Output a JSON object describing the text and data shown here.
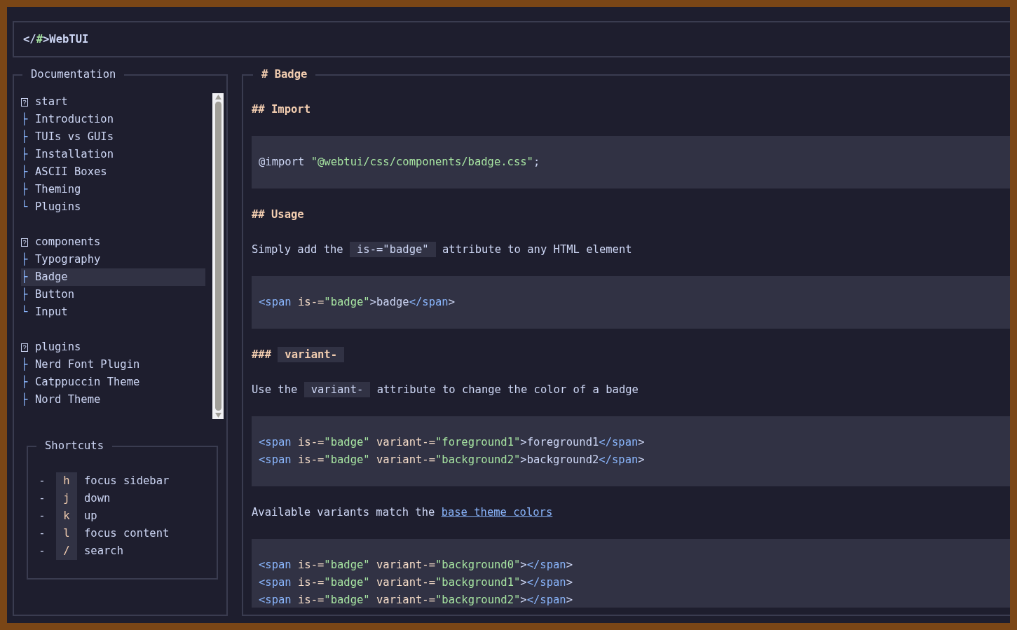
{
  "header": {
    "logo": [
      {
        "kind": "plain",
        "text": "</"
      },
      {
        "kind": "accent",
        "text": "#"
      },
      {
        "kind": "plain",
        "text": ">WebTUI"
      }
    ]
  },
  "sidebar": {
    "title": "Documentation",
    "groups": [
      {
        "label": "start",
        "children": [
          {
            "branch": "├",
            "label": "Introduction",
            "selected": false
          },
          {
            "branch": "├",
            "label": "TUIs vs GUIs",
            "selected": false
          },
          {
            "branch": "├",
            "label": "Installation",
            "selected": false
          },
          {
            "branch": "├",
            "label": "ASCII Boxes",
            "selected": false
          },
          {
            "branch": "├",
            "label": "Theming",
            "selected": false
          },
          {
            "branch": "└",
            "label": "Plugins",
            "selected": false
          }
        ]
      },
      {
        "label": "components",
        "children": [
          {
            "branch": "├",
            "label": "Typography",
            "selected": false
          },
          {
            "branch": "├",
            "label": "Badge",
            "selected": true
          },
          {
            "branch": "├",
            "label": "Button",
            "selected": false
          },
          {
            "branch": "└",
            "label": "Input",
            "selected": false
          }
        ]
      },
      {
        "label": "plugins",
        "children": [
          {
            "branch": "├",
            "label": "Nerd Font Plugin",
            "selected": false
          },
          {
            "branch": "├",
            "label": "Catppuccin Theme",
            "selected": false
          },
          {
            "branch": "├",
            "label": "Nord Theme",
            "selected": false
          }
        ]
      }
    ]
  },
  "shortcuts": {
    "title": "Shortcuts",
    "items": [
      {
        "bullet": "-",
        "key": "h",
        "action": "focus sidebar"
      },
      {
        "bullet": "-",
        "key": "j",
        "action": "down"
      },
      {
        "bullet": "-",
        "key": "k",
        "action": "up"
      },
      {
        "bullet": "-",
        "key": "l",
        "action": "focus content"
      },
      {
        "bullet": "-",
        "key": "/",
        "action": "search"
      }
    ]
  },
  "content": {
    "title": "# Badge",
    "blocks": [
      {
        "kind": "heading",
        "parts": [
          {
            "kind": "text",
            "text": "## Import"
          }
        ]
      },
      {
        "kind": "code",
        "lines": [
          [
            {
              "kind": "plain",
              "text": "@import "
            },
            {
              "kind": "str",
              "text": "\"@webtui/css/components/badge.css\""
            },
            {
              "kind": "plain",
              "text": ";"
            }
          ]
        ]
      },
      {
        "kind": "heading",
        "parts": [
          {
            "kind": "text",
            "text": "## Usage"
          }
        ]
      },
      {
        "kind": "para",
        "parts": [
          {
            "kind": "text",
            "text": "Simply add the "
          },
          {
            "kind": "code",
            "text": "is-=\"badge\""
          },
          {
            "kind": "text",
            "text": " attribute to any HTML element"
          }
        ]
      },
      {
        "kind": "code",
        "lines": [
          [
            {
              "kind": "tag",
              "text": "<span"
            },
            {
              "kind": "attr",
              "text": " is-="
            },
            {
              "kind": "str",
              "text": "\"badge\""
            },
            {
              "kind": "plain",
              "text": ">badge"
            },
            {
              "kind": "tag",
              "text": "</span"
            },
            {
              "kind": "plain",
              "text": ">"
            }
          ]
        ]
      },
      {
        "kind": "heading",
        "parts": [
          {
            "kind": "text",
            "text": "### "
          },
          {
            "kind": "code",
            "text": "variant-"
          }
        ]
      },
      {
        "kind": "para",
        "parts": [
          {
            "kind": "text",
            "text": "Use the "
          },
          {
            "kind": "code",
            "text": "variant-"
          },
          {
            "kind": "text",
            "text": " attribute to change the color of a badge"
          }
        ]
      },
      {
        "kind": "code",
        "lines": [
          [
            {
              "kind": "tag",
              "text": "<span"
            },
            {
              "kind": "attr",
              "text": " is-="
            },
            {
              "kind": "str",
              "text": "\"badge\""
            },
            {
              "kind": "attr",
              "text": " variant-="
            },
            {
              "kind": "str",
              "text": "\"foreground1\""
            },
            {
              "kind": "plain",
              "text": ">foreground1"
            },
            {
              "kind": "tag",
              "text": "</span"
            },
            {
              "kind": "plain",
              "text": ">"
            }
          ],
          [
            {
              "kind": "tag",
              "text": "<span"
            },
            {
              "kind": "attr",
              "text": " is-="
            },
            {
              "kind": "str",
              "text": "\"badge\""
            },
            {
              "kind": "attr",
              "text": " variant-="
            },
            {
              "kind": "str",
              "text": "\"background2\""
            },
            {
              "kind": "plain",
              "text": ">background2"
            },
            {
              "kind": "tag",
              "text": "</span"
            },
            {
              "kind": "plain",
              "text": ">"
            }
          ]
        ]
      },
      {
        "kind": "para",
        "parts": [
          {
            "kind": "text",
            "text": "Available variants match the "
          },
          {
            "kind": "link",
            "text": "base theme colors"
          }
        ]
      },
      {
        "kind": "code",
        "lines": [
          [
            {
              "kind": "tag",
              "text": "<span"
            },
            {
              "kind": "attr",
              "text": " is-="
            },
            {
              "kind": "str",
              "text": "\"badge\""
            },
            {
              "kind": "attr",
              "text": " variant-="
            },
            {
              "kind": "str",
              "text": "\"background0\""
            },
            {
              "kind": "plain",
              "text": ">"
            },
            {
              "kind": "tag",
              "text": "</span"
            },
            {
              "kind": "plain",
              "text": ">"
            }
          ],
          [
            {
              "kind": "tag",
              "text": "<span"
            },
            {
              "kind": "attr",
              "text": " is-="
            },
            {
              "kind": "str",
              "text": "\"badge\""
            },
            {
              "kind": "attr",
              "text": " variant-="
            },
            {
              "kind": "str",
              "text": "\"background1\""
            },
            {
              "kind": "plain",
              "text": ">"
            },
            {
              "kind": "tag",
              "text": "</span"
            },
            {
              "kind": "plain",
              "text": ">"
            }
          ],
          [
            {
              "kind": "tag",
              "text": "<span"
            },
            {
              "kind": "attr",
              "text": " is-="
            },
            {
              "kind": "str",
              "text": "\"badge\""
            },
            {
              "kind": "attr",
              "text": " variant-="
            },
            {
              "kind": "str",
              "text": "\"background2\""
            },
            {
              "kind": "plain",
              "text": ">"
            },
            {
              "kind": "tag",
              "text": "</span"
            },
            {
              "kind": "plain",
              "text": ">"
            }
          ]
        ]
      }
    ]
  }
}
